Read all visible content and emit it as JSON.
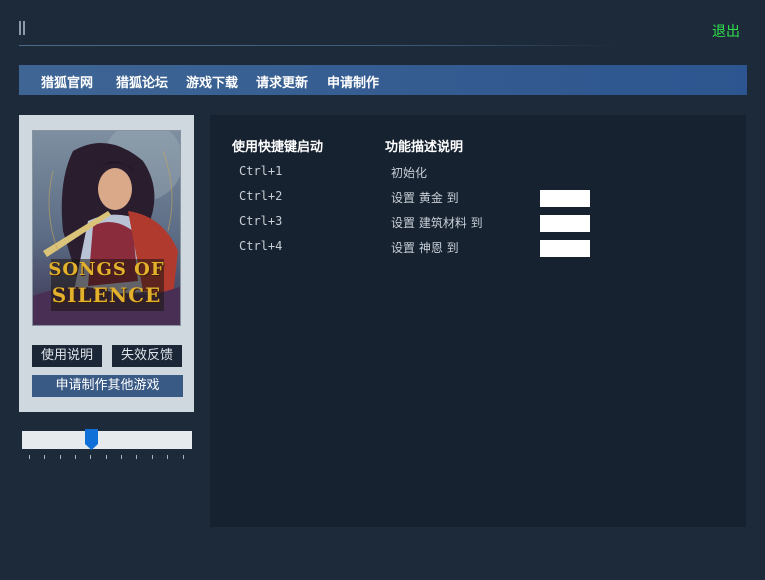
{
  "window": {
    "exit_label": "退出"
  },
  "nav": {
    "items": [
      "猎狐官网",
      "猎狐论坛",
      "游戏下载",
      "请求更新",
      "申请制作"
    ]
  },
  "game": {
    "title_line1": "SONGS OF",
    "title_line2": "SILENCE"
  },
  "sidebar": {
    "help_button": "使用说明",
    "feedback_button": "失效反馈",
    "request_button": "申请制作其他游戏"
  },
  "hotkeys": {
    "header_key": "使用快捷键启动",
    "header_desc": "功能描述说明",
    "rows": [
      {
        "key": "Ctrl+1",
        "desc": "初始化",
        "input": null
      },
      {
        "key": "Ctrl+2",
        "desc": "设置 黄金 到",
        "input": ""
      },
      {
        "key": "Ctrl+3",
        "desc": "设置 建筑材料 到",
        "input": ""
      },
      {
        "key": "Ctrl+4",
        "desc": "设置 神恩 到",
        "input": ""
      }
    ]
  },
  "colors": {
    "accent_green": "#2fe04b",
    "nav_blue": "#2d558f",
    "panel_bg": "#172230"
  }
}
